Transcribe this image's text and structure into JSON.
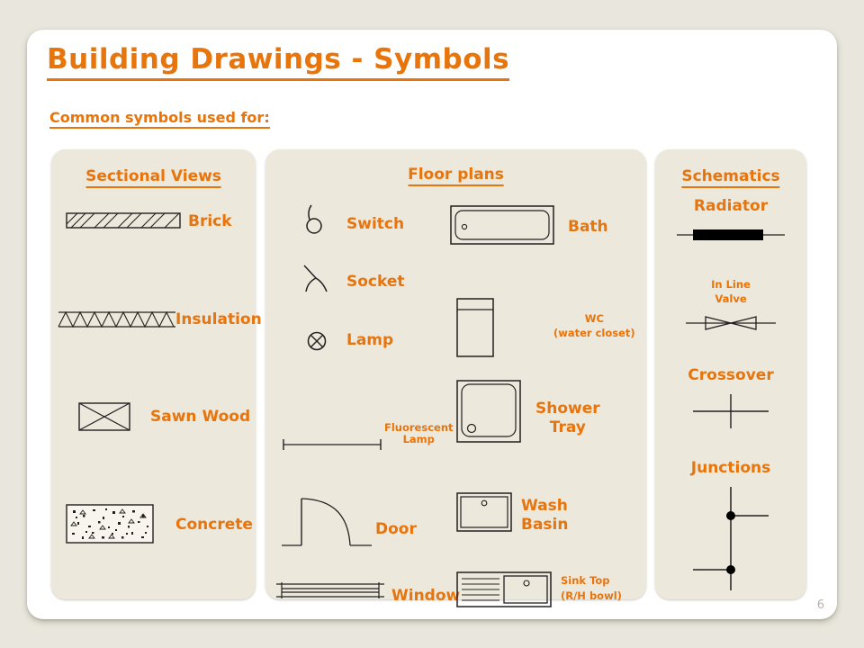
{
  "slide": {
    "title": "Building Drawings - Symbols",
    "subtitle": "Common symbols used for:",
    "page_number": "6",
    "accent_color": "#e8740c",
    "panel_bg": "#ece8dc",
    "card_bg": "#ffffff",
    "background": "#e9e7dd",
    "ink_color": "#231f20"
  },
  "panels": [
    {
      "id": "sectional",
      "title": "Sectional Views",
      "items": [
        {
          "label": "Brick",
          "symbol": "brick-hatch-symbol"
        },
        {
          "label": "Insulation",
          "symbol": "insulation-zigzag-symbol"
        },
        {
          "label": "Sawn Wood",
          "symbol": "sawn-wood-cross-symbol"
        },
        {
          "label": "Concrete",
          "symbol": "concrete-speckle-symbol"
        }
      ]
    },
    {
      "id": "floor",
      "title": "Floor plans",
      "items": [
        {
          "label": "Switch",
          "symbol": "switch-symbol"
        },
        {
          "label": "Socket",
          "symbol": "socket-symbol"
        },
        {
          "label": "Lamp",
          "symbol": "lamp-symbol"
        },
        {
          "label": "Fluorescent\nLamp",
          "symbol": "fluorescent-lamp-symbol"
        },
        {
          "label": "Door",
          "symbol": "door-symbol"
        },
        {
          "label": "Window",
          "symbol": "window-symbol"
        },
        {
          "label": "Bath",
          "symbol": "bath-symbol"
        },
        {
          "label": "WC\n(water closet)",
          "symbol": "wc-symbol"
        },
        {
          "label": "Shower\nTray",
          "symbol": "shower-tray-symbol"
        },
        {
          "label": "Wash\nBasin",
          "symbol": "wash-basin-symbol"
        },
        {
          "label": "Sink Top\n(R/H bowl)",
          "symbol": "sink-top-symbol"
        }
      ]
    },
    {
      "id": "schematics",
      "title": "Schematics",
      "items": [
        {
          "label": "Radiator",
          "symbol": "radiator-symbol"
        },
        {
          "label": "In Line\nValve",
          "symbol": "in-line-valve-symbol"
        },
        {
          "label": "Crossover",
          "symbol": "crossover-symbol"
        },
        {
          "label": "Junctions",
          "symbol": "junctions-symbol"
        }
      ]
    }
  ]
}
